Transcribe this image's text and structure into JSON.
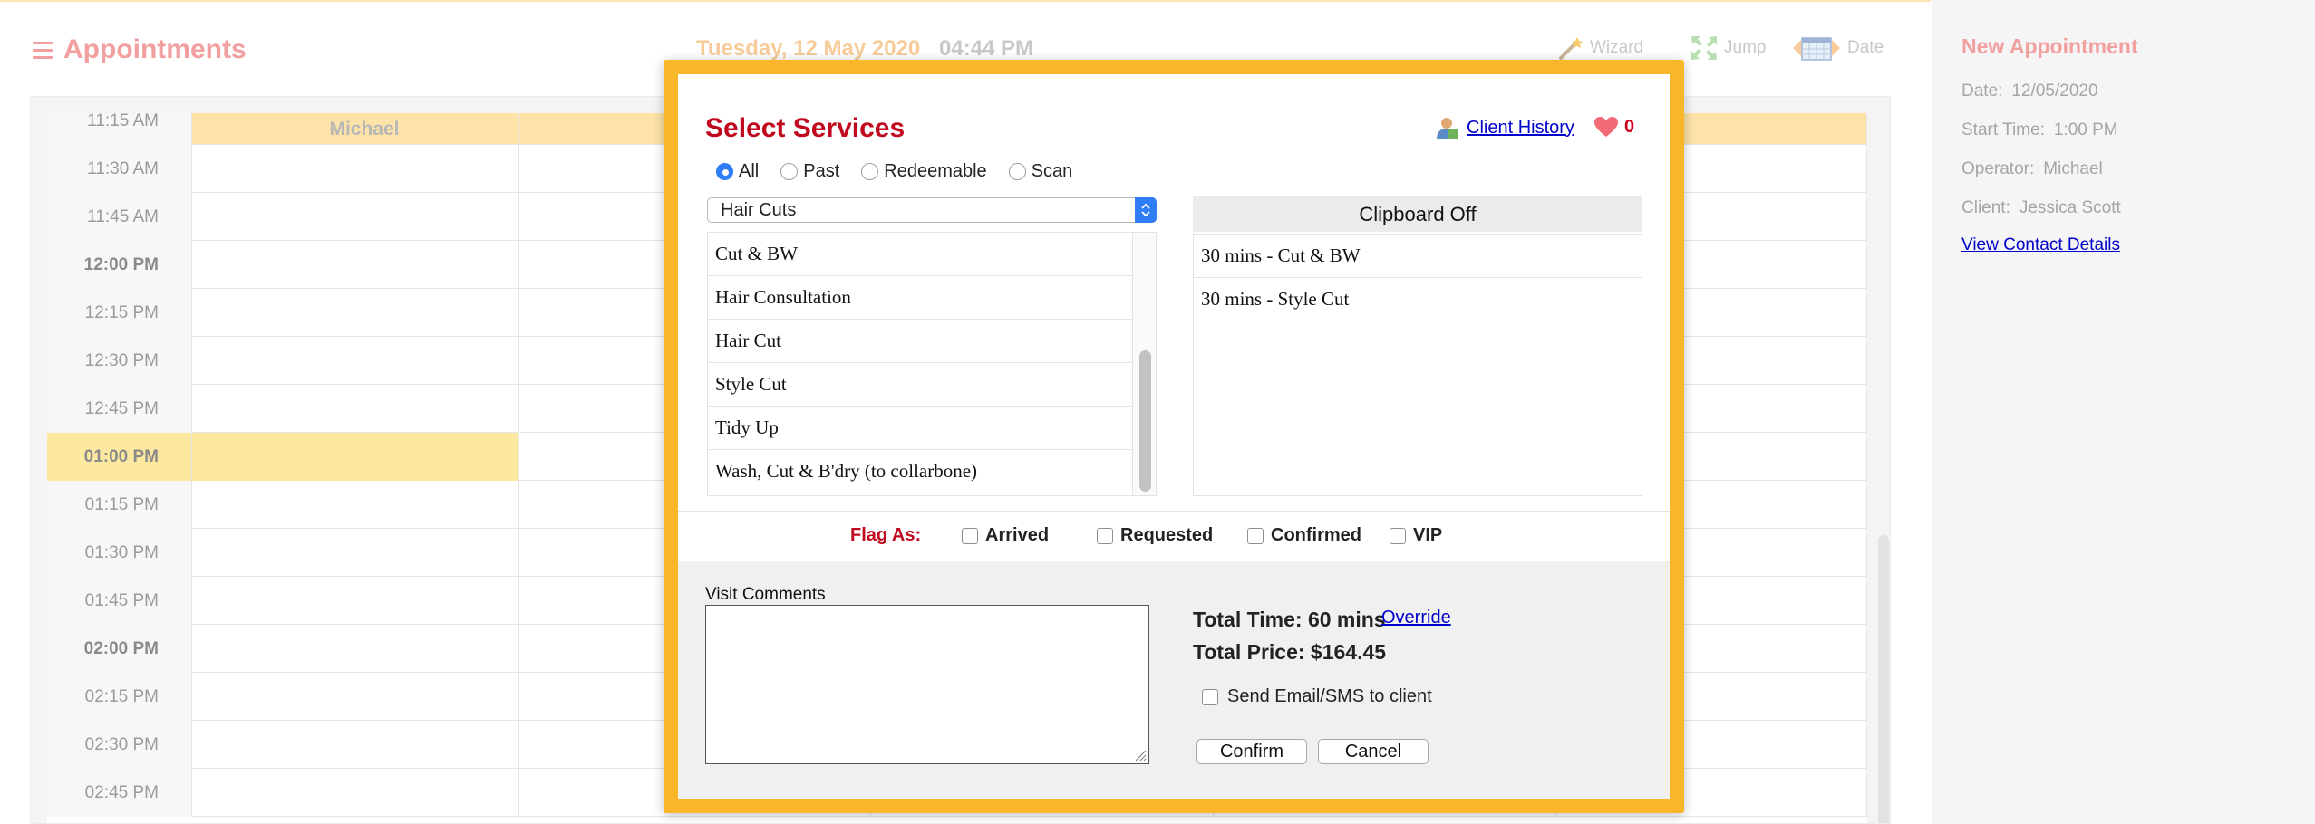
{
  "header": {
    "title": "Appointments",
    "date": "Tuesday, 12 May 2020",
    "time": "04:44 PM",
    "tools": {
      "wizard": "Wizard",
      "jump": "Jump",
      "date": "Date"
    }
  },
  "calendar": {
    "operator_column": "Michael",
    "partial_time": "11:15 AM",
    "times": [
      "11:30 AM",
      "11:45 AM",
      "12:00 PM",
      "12:15 PM",
      "12:30 PM",
      "12:45 PM",
      "01:00 PM",
      "01:15 PM",
      "01:30 PM",
      "01:45 PM",
      "02:00 PM",
      "02:15 PM",
      "02:30 PM",
      "02:45 PM"
    ]
  },
  "new_appointment": {
    "title": "New Appointment",
    "date_label": "Date:",
    "date_value": "12/05/2020",
    "start_label": "Start Time:",
    "start_value": "1:00 PM",
    "operator_label": "Operator:",
    "operator_value": "Michael",
    "client_label": "Client:",
    "client_value": "Jessica Scott",
    "contact_link": "View Contact Details"
  },
  "modal": {
    "title": "Select Services",
    "client_history": "Client History",
    "favourites_count": "0",
    "filters": [
      "All",
      "Past",
      "Redeemable",
      "Scan"
    ],
    "selected_filter": "All",
    "category": "Hair Cuts",
    "services": [
      "Cut & BW",
      "Hair Consultation",
      "Hair Cut",
      "Style Cut",
      "Tidy Up",
      "Wash, Cut & B'dry (to collarbone)"
    ],
    "clipboard": "Clipboard Off",
    "selected": [
      "30 mins - Cut & BW",
      "30 mins - Style Cut"
    ],
    "flag_label": "Flag As:",
    "flags": [
      "Arrived",
      "Requested",
      "Confirmed",
      "VIP"
    ],
    "visit_comments_label": "Visit Comments",
    "total_time": "Total Time: 60 mins",
    "override": "Override",
    "total_price": "Total Price: $164.45",
    "send_label": "Send Email/SMS to client",
    "confirm": "Confirm",
    "cancel": "Cancel"
  },
  "colors": {
    "accent": "#f9b62b",
    "brand_red": "#c0091e",
    "header_pink": "#f2a09f",
    "highlight": "#fde89f",
    "link": "#0000cc",
    "radio_blue": "#2f7ef6"
  }
}
